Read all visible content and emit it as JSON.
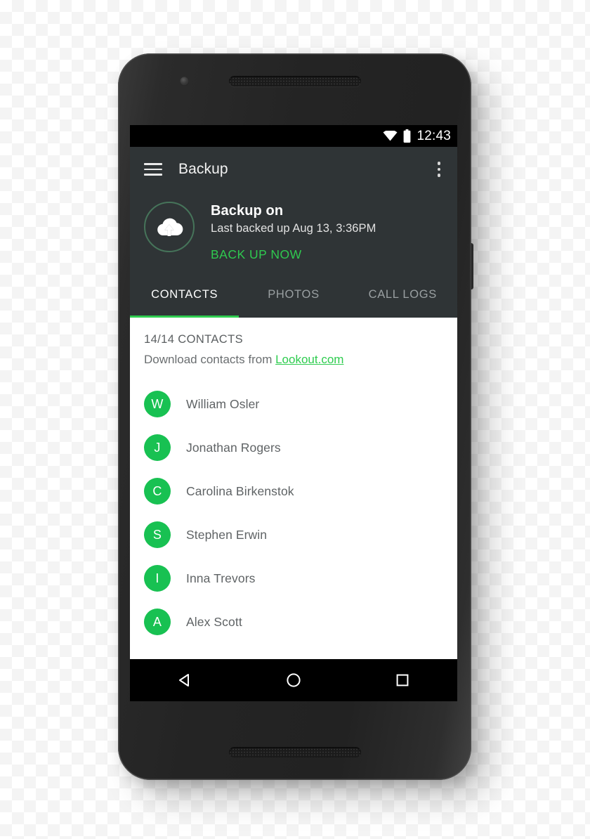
{
  "device": {
    "type": "android-smartphone",
    "hardware": {
      "front_camera": "front-camera",
      "earpiece": "earpiece-speaker",
      "bottom_speaker": "bottom-speaker",
      "side_button": "power-button"
    }
  },
  "status_bar": {
    "time": "12:43",
    "icons": [
      "wifi-icon",
      "battery-icon"
    ]
  },
  "app_bar": {
    "menu_icon": "hamburger-menu-icon",
    "title": "Backup",
    "overflow_icon": "overflow-menu-icon"
  },
  "backup_panel": {
    "icon": "cloud-upload-icon",
    "title": "Backup on",
    "subtitle": "Last backed up Aug 13, 3:36PM",
    "action_label": "BACK UP NOW"
  },
  "tabs": [
    {
      "label": "CONTACTS",
      "active": true
    },
    {
      "label": "PHOTOS",
      "active": false
    },
    {
      "label": "CALL LOGS",
      "active": false
    }
  ],
  "contacts_panel": {
    "count_label": "14/14 CONTACTS",
    "download_prefix": "Download contacts from ",
    "download_link": "Lookout.com",
    "items": [
      {
        "initial": "W",
        "name": "William Osler"
      },
      {
        "initial": "J",
        "name": "Jonathan Rogers"
      },
      {
        "initial": "C",
        "name": "Carolina Birkenstok"
      },
      {
        "initial": "S",
        "name": "Stephen Erwin"
      },
      {
        "initial": "I",
        "name": "Inna Trevors"
      },
      {
        "initial": "A",
        "name": "Alex Scott"
      }
    ]
  },
  "nav_bar": {
    "back": "back-triangle-icon",
    "home": "home-circle-icon",
    "recents": "recents-square-icon"
  },
  "colors": {
    "accent_green": "#2ECC4F",
    "avatar_green": "#18C152",
    "app_bar_dark": "#2F3436",
    "status_bar_black": "#000000",
    "cloud_ring": "#46745A"
  }
}
